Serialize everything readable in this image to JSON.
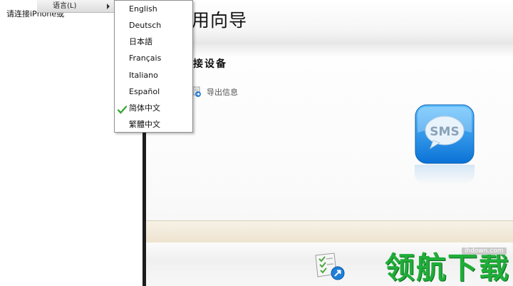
{
  "left_pane": {
    "device_prompt": "请连接iPhone或"
  },
  "menubar": {
    "language_label": "语言(L)"
  },
  "language_menu": {
    "options": [
      {
        "label": "English",
        "checked": false
      },
      {
        "label": "Deutsch",
        "checked": false
      },
      {
        "label": "日本語",
        "checked": false
      },
      {
        "label": "Français",
        "checked": false
      },
      {
        "label": "Italiano",
        "checked": false
      },
      {
        "label": "Español",
        "checked": false
      },
      {
        "label": "简体中文",
        "checked": true
      },
      {
        "label": "繁體中文",
        "checked": false
      }
    ]
  },
  "main": {
    "title": "用向导",
    "section_title": "接设备",
    "export_label": "导出信息",
    "sms_label": "SMS"
  },
  "watermark": {
    "text": "领航下载",
    "url": "ihdown.com"
  },
  "colors": {
    "accent_blue": "#1e8fe0",
    "watermark_green": "#1fae38",
    "check_green": "#3aa83a"
  }
}
